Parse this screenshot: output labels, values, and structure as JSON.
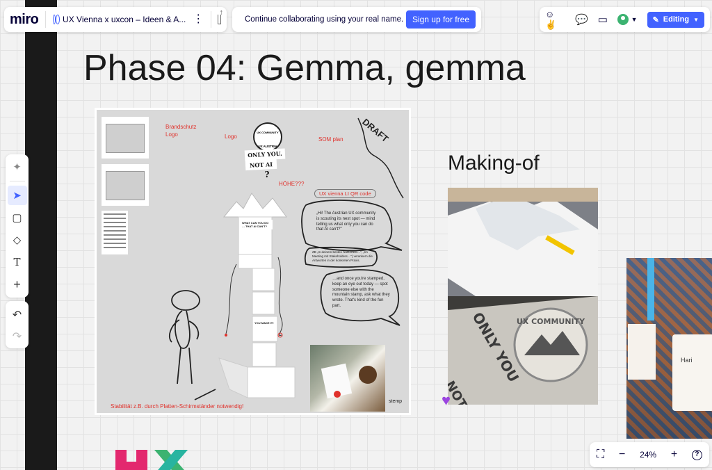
{
  "header": {
    "logo": "miro",
    "board_title": "UX Vienna x uxcon – Ideen & A...",
    "kebab": "⋮",
    "collab_text": "Continue collaborating using your real name.",
    "signup_label": "Sign up for free",
    "editing_label": "Editing"
  },
  "toolbar": {
    "items": [
      "ai-sparkle",
      "select",
      "sticky-note",
      "shapes",
      "text",
      "add"
    ],
    "undo": "undo",
    "redo": "redo"
  },
  "board": {
    "phase_title": "Phase 04: Gemma, gemma",
    "making_of": "Making-of",
    "labels": {
      "brandschutz": "Brandschutz",
      "logo1": "Logo",
      "logo2": "Logo",
      "som_plan": "SOM plan",
      "hoehe": "HÖHE???",
      "qr": "UX vienna LI QR code",
      "draft": "DRAFT",
      "only_you": "ONLY YOU.",
      "not_ai": "NOT AI",
      "question": "?",
      "community": "UX AUSTRIA",
      "community_arc": "UX COMMUNITY",
      "bubble1": "„Hi! The Austrian UX community is scouting its next spot — mind telling us what only you can do that AI can't?\"",
      "bubble2": "ZB „In deinem besten Nutzertest…\", „Im Meeting mit Stakeholders…\") verankern die Antworten in der konkreten Praxis.",
      "bubble3": "…and once you're stamped, keep an eye out today — spot someone else with the mountain stamp, ask what they wrote. That's kind of the fun part.",
      "stemp": "stemp",
      "stability": "Stabilität z.B. durch Platten-Schirmständer notwendig!",
      "tower_top": "WHAT CAN YOU DO … THAT AI CAN'T?",
      "you_made_it": "YOU MADE IT!"
    },
    "photo_text": {
      "stencil_arc": "UX COMMUNITY",
      "stencil_only": "ONLY YOU",
      "stencil_notai": "NOT AI",
      "badge_name": "Hari"
    }
  },
  "zoom": {
    "value": "24%"
  },
  "colors": {
    "accent": "#4262ff",
    "annotation_red": "#e0312b",
    "frame_bg": "#d9d9d9"
  }
}
